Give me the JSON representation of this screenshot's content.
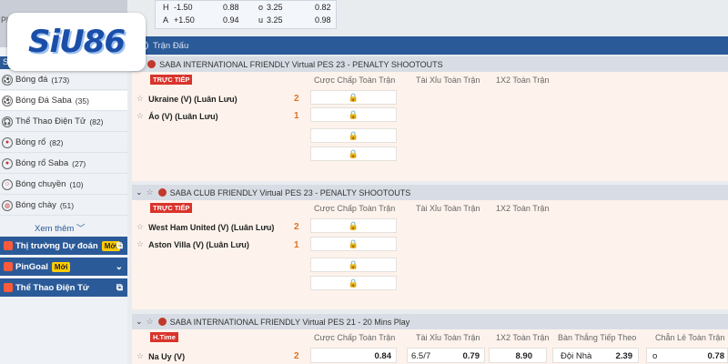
{
  "brand": {
    "logo": "SiU86"
  },
  "topstrip": {
    "phu": "Phu",
    "su": "Su"
  },
  "top_odds": [
    {
      "a": "H",
      "b": "-1.50",
      "c": "0.88",
      "d": "o",
      "e": "3.25",
      "f": "0.82"
    },
    {
      "a": "A",
      "b": "+1.50",
      "c": "0.94",
      "d": "u",
      "e": "3.25",
      "f": "0.98"
    }
  ],
  "sidebar": {
    "items": [
      {
        "label": "Bóng đá",
        "count": "(173)"
      },
      {
        "label": "Bóng Đá Saba",
        "count": "(35)"
      },
      {
        "label": "Thể Thao Điện Tử",
        "count": "(82)"
      },
      {
        "label": "Bóng rổ",
        "count": "(82)"
      },
      {
        "label": "Bóng rổ Saba",
        "count": "(27)"
      },
      {
        "label": "Bóng chuyền",
        "count": "(10)"
      },
      {
        "label": "Bóng chày",
        "count": "(51)"
      }
    ],
    "more": "Xem thêm ﹀",
    "promos": [
      {
        "label": "Thị trường Dự đoán",
        "badge": "Mới"
      },
      {
        "label": "PinGoal",
        "badge": "Mới"
      },
      {
        "label": "Thể Thao Điện Tử",
        "badge": ""
      }
    ]
  },
  "main": {
    "title": "Trận Đấu"
  },
  "leagues": [
    {
      "name": "SABA INTERNATIONAL FRIENDLY Virtual PES 23 - PENALTY SHOOTOUTS",
      "status": "TRỰC TIẾP",
      "cols": [
        "Cược Chấp Toàn Trận",
        "Tài Xỉu Toàn Trận",
        "1X2 Toàn Trận"
      ],
      "teams": [
        {
          "name": "Ukraine (V) (Luân Lưu)",
          "score": "2"
        },
        {
          "name": "Áo (V) (Luân Lưu)",
          "score": "1"
        }
      ]
    },
    {
      "name": "SABA CLUB FRIENDLY Virtual PES 23 - PENALTY SHOOTOUTS",
      "status": "TRỰC TIẾP",
      "cols": [
        "Cược Chấp Toàn Trận",
        "Tài Xỉu Toàn Trận",
        "1X2 Toàn Trận"
      ],
      "teams": [
        {
          "name": "West Ham United (V) (Luân Lưu)",
          "score": "2"
        },
        {
          "name": "Aston Villa (V) (Luân Lưu)",
          "score": "1"
        }
      ]
    },
    {
      "name": "SABA INTERNATIONAL FRIENDLY Virtual PES 21 - 20 Mins Play",
      "status": "H.Time",
      "cols": [
        "Cược Chấp Toàn Trận",
        "Tài Xỉu Toàn Trận",
        "1X2 Toàn Trận",
        "Bàn Thắng Tiếp Theo",
        "Chẵn Lẻ Toàn Trận"
      ],
      "teams": [
        {
          "name": "Na Uy (V)",
          "score": "2"
        }
      ],
      "odds": {
        "hdp": "0.84",
        "ou_line": "6.5/7",
        "ou": "0.79",
        "x12": "8.90",
        "next_label": "Đội Nhà",
        "next": "2.39",
        "oe_label": "o",
        "oe": "0.78"
      }
    }
  ],
  "lock_icon": "🔒"
}
